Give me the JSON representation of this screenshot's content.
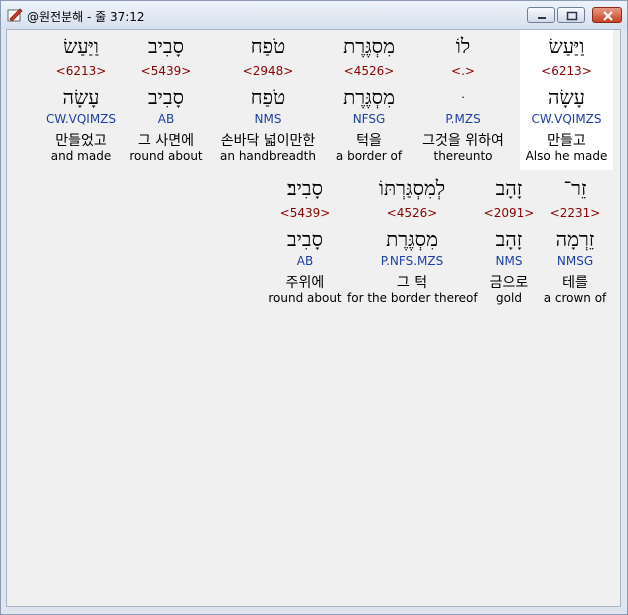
{
  "window": {
    "title": "@원전분해 - 줄 37:12"
  },
  "rows": [
    [
      {
        "h1": "וַיַּעַשׂ",
        "num": "<6213>",
        "h2": "עָשָׂה",
        "parse": "CW.VQIMZS",
        "kor": "만들었고",
        "eng": "and made"
      },
      {
        "h1": "סָבִיב",
        "num": "<5439>",
        "h2": "סָבִיב",
        "parse": "AB",
        "kor": "그 사면에",
        "eng": "round about"
      },
      {
        "h1": "טֹפַח",
        "num": "<2948>",
        "h2": "טֹפַח",
        "parse": "NMS",
        "kor": "손바닥 넓이만한",
        "eng": "an handbreadth"
      },
      {
        "h1": "מִסְגֶּרֶת",
        "num": "<4526>",
        "h2": "מִסְגֶּרֶת",
        "parse": "NFSG",
        "kor": "턱을",
        "eng": "a border of"
      },
      {
        "h1": "לוֹ",
        "num": "<.>",
        "h2": "ּ",
        "parse": "P.MZS",
        "kor": "그것을 위하여",
        "eng": "thereunto"
      },
      {
        "h1": "וַיַּעַשׂ",
        "num": "<6213>",
        "h2": "עָשָׂה",
        "parse": "CW.VQIMZS",
        "kor": "만들고",
        "eng": "Also he made"
      }
    ],
    [
      {
        "h1": "סָבִיב׃",
        "num": "<5439>",
        "h2": "סָבִיב",
        "parse": "AB",
        "kor": "주위에",
        "eng": "round about"
      },
      {
        "h1": "לְמִסְגַּרְתּוֹ",
        "num": "<4526>",
        "h2": "מִסְגֶּרֶת",
        "parse": "P.NFS.MZS",
        "kor": "그 턱",
        "eng": "for the border thereof"
      },
      {
        "h1": "זָהָב",
        "num": "<2091>",
        "h2": "זָהָב",
        "parse": "NMS",
        "kor": "금으로",
        "eng": "gold"
      },
      {
        "h1": "זֵר־",
        "num": "<2231>",
        "h2": "זֵרְמָה",
        "parse": "NMSG",
        "kor": "테를",
        "eng": "a crown of"
      }
    ]
  ]
}
